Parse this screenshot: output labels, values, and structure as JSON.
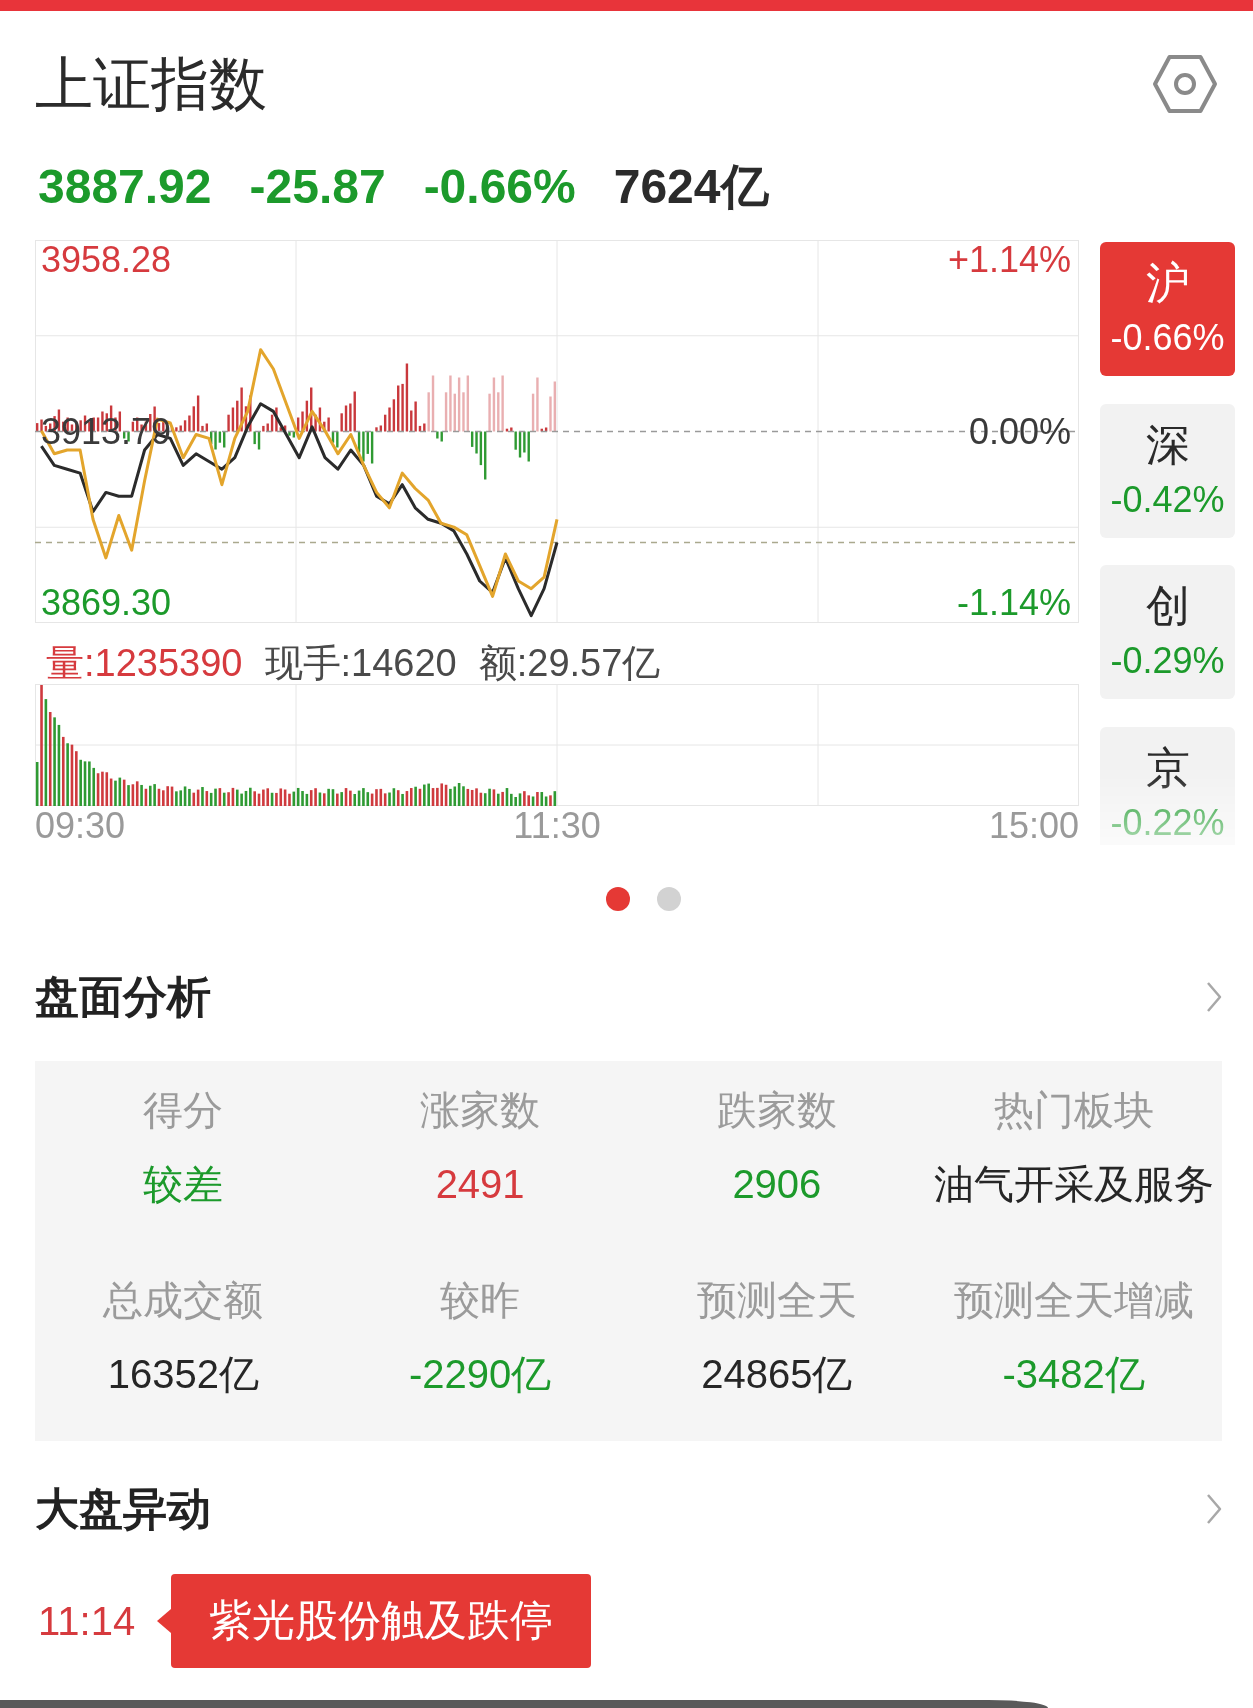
{
  "header": {
    "title": "上证指数"
  },
  "quote": {
    "price": "3887.92",
    "change": "-25.87",
    "change_percent": "-0.66%",
    "falling": true,
    "turnover": "7624亿"
  },
  "main_chart": {
    "percent_labels": [
      {
        "text": "+1.14%",
        "color": "#d63a3e"
      },
      {
        "text": "0.00%",
        "color": "#3a3a3a"
      },
      {
        "text": "-1.14%",
        "color": "#1c9a2b"
      }
    ],
    "chart_data": {
      "type": "line",
      "categories": [
        null,
        null,
        null,
        null,
        null,
        null,
        null,
        null,
        null,
        null,
        null,
        null,
        null,
        null,
        null,
        null,
        null,
        null,
        null,
        null,
        null,
        null,
        null,
        null,
        null,
        null,
        null,
        null,
        null,
        null,
        null,
        null,
        null,
        null,
        null,
        null,
        null,
        null,
        null,
        null,
        null,
        null,
        null,
        null,
        null,
        null,
        null,
        null,
        null,
        null,
        null,
        null,
        null,
        null,
        null,
        null,
        null,
        null,
        null,
        null,
        null,
        null,
        null,
        null,
        null,
        null,
        null,
        null,
        null,
        null,
        null,
        null,
        null,
        null,
        null,
        null,
        null,
        null,
        null,
        null,
        null
      ],
      "series": [
        {
          "color": "#2b2b2b",
          "values": [
            3910,
            3905,
            3904,
            3903,
            3893,
            3898,
            3897,
            3897,
            3909,
            3913,
            3912,
            3905,
            3908,
            3906,
            3904,
            3907,
            3915,
            3921,
            3919,
            3913,
            3907,
            3915,
            3907,
            3904,
            3909,
            3905,
            3897,
            3895,
            3900,
            3894,
            3891,
            3890,
            3888,
            3882,
            3875,
            3872,
            3881,
            3873,
            3866,
            3873,
            3885,
            null,
            null,
            null,
            null,
            null,
            null,
            null,
            null,
            null,
            null,
            null,
            null,
            null,
            null,
            null,
            null,
            null,
            null,
            null,
            null,
            null,
            null,
            null,
            null,
            null,
            null,
            null,
            null,
            null,
            null,
            null,
            null,
            null,
            null,
            null,
            null,
            null,
            null,
            null,
            null
          ]
        },
        {
          "color": "#e3a52c",
          "values": [
            3914,
            3908,
            3909,
            3909,
            3891,
            3881,
            3892,
            3883,
            3901,
            3917,
            3916,
            3907,
            3913,
            3912,
            3900,
            3912,
            3919,
            3935,
            3930,
            3921,
            3912,
            3919,
            3914,
            3908,
            3913,
            3905,
            3898,
            3894,
            3903,
            3899,
            3896,
            3890,
            3889,
            3887,
            3879,
            3871,
            3882,
            3875,
            3873,
            3876,
            3891,
            null,
            null,
            null,
            null,
            null,
            null,
            null,
            null,
            null,
            null,
            null,
            null,
            null,
            null,
            null,
            null,
            null,
            null,
            null,
            null,
            null,
            null,
            null,
            null,
            null,
            null,
            null,
            null,
            null,
            null,
            null,
            null,
            null,
            null,
            null,
            null,
            null,
            null,
            null,
            null
          ]
        }
      ],
      "ylim": [
        3864.11,
        3963.47
      ],
      "yticks": [
        {
          "value": 3958.28,
          "label": "3958.28"
        },
        {
          "value": 3913.79,
          "label": "3913.79"
        },
        {
          "value": 3869.3,
          "label": "3869.30"
        }
      ],
      "ref_lines": [
        {
          "axis": "y",
          "value": 3913.79
        },
        {
          "axis": "y",
          "value": 3885
        }
      ]
    }
  },
  "volume": {
    "readings": [
      {
        "text": "量:1235390",
        "color": "#d63a3e"
      },
      {
        "text": "现手:14620",
        "color": "#4a4a4a"
      },
      {
        "text": "额:29.57亿",
        "color": "#4a4a4a"
      }
    ],
    "time_labels": [
      "09:30",
      "11:30",
      "15:00"
    ]
  },
  "markets": [
    {
      "label": "沪",
      "change": "-0.66%",
      "selected": true
    },
    {
      "label": "深",
      "change": "-0.42%",
      "falling": true,
      "selected": false
    },
    {
      "label": "创",
      "change": "-0.29%",
      "falling": true,
      "selected": false
    },
    {
      "label": "京",
      "change": "-0.22%",
      "falling": true,
      "selected": false
    }
  ],
  "pager": [
    {
      "selected": true
    },
    {
      "selected": false
    }
  ],
  "analysis": {
    "title": "盘面分析",
    "cells": [
      {
        "label": "得分",
        "value": "较差",
        "color": "#1c9a2b"
      },
      {
        "label": "涨家数",
        "value": "2491",
        "color": "#d63a3e"
      },
      {
        "label": "跌家数",
        "value": "2906",
        "color": "#1c9a2b"
      },
      {
        "label": "热门板块",
        "value": "油气开采及服务",
        "color": "#262626"
      },
      {
        "label": "总成交额",
        "value": "16352亿",
        "color": "#262626"
      },
      {
        "label": "较昨",
        "value": "-2290亿",
        "color": "#1c9a2b"
      },
      {
        "label": "预测全天",
        "value": "24865亿",
        "color": "#262626"
      },
      {
        "label": "预测全天增减",
        "value": "-3482亿",
        "color": "#1c9a2b"
      }
    ]
  },
  "movements": {
    "title": "大盘异动",
    "events": [
      {
        "time": "11:14",
        "text": "紫光股份触及跌停"
      }
    ]
  }
}
